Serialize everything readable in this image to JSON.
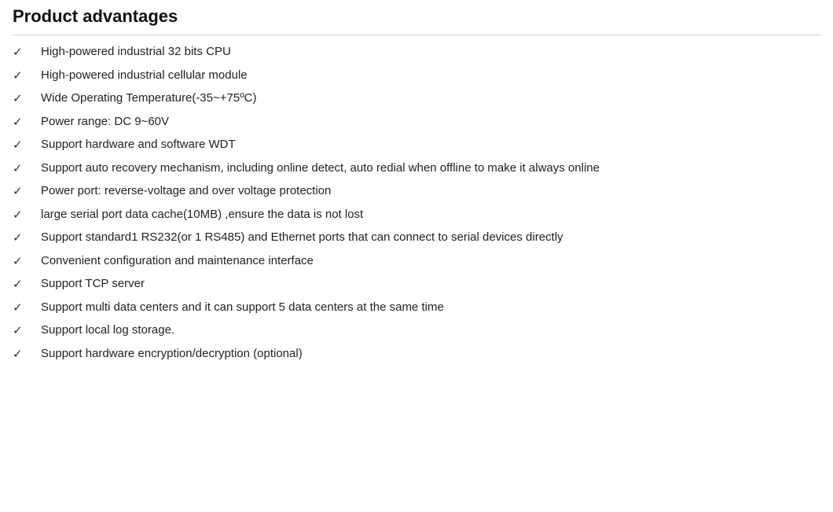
{
  "page": {
    "title": "Product advantages",
    "items": [
      {
        "id": 1,
        "text": "High-powered industrial 32 bits CPU"
      },
      {
        "id": 2,
        "text": "High-powered industrial cellular module"
      },
      {
        "id": 3,
        "text": "Wide Operating Temperature(-35~+75ºC)"
      },
      {
        "id": 4,
        "text": "Power range: DC 9~60V"
      },
      {
        "id": 5,
        "text": "Support hardware and software WDT"
      },
      {
        "id": 6,
        "text": "Support auto recovery mechanism, including online detect, auto redial when offline to make it always online"
      },
      {
        "id": 7,
        "text": "Power port: reverse-voltage and over voltage protection"
      },
      {
        "id": 8,
        "text": "large serial port data cache(10MB) ,ensure the data is not lost"
      },
      {
        "id": 9,
        "text": "Support standard1 RS232(or 1 RS485) and Ethernet ports that can connect to serial devices directly"
      },
      {
        "id": 10,
        "text": "Convenient configuration and maintenance interface"
      },
      {
        "id": 11,
        "text": "Support TCP server"
      },
      {
        "id": 12,
        "text": "Support multi data centers and it can support 5 data centers at the same time"
      },
      {
        "id": 13,
        "text": "Support local log storage."
      },
      {
        "id": 14,
        "text": "Support hardware encryption/decryption (optional)"
      }
    ],
    "check_symbol": "✓"
  }
}
